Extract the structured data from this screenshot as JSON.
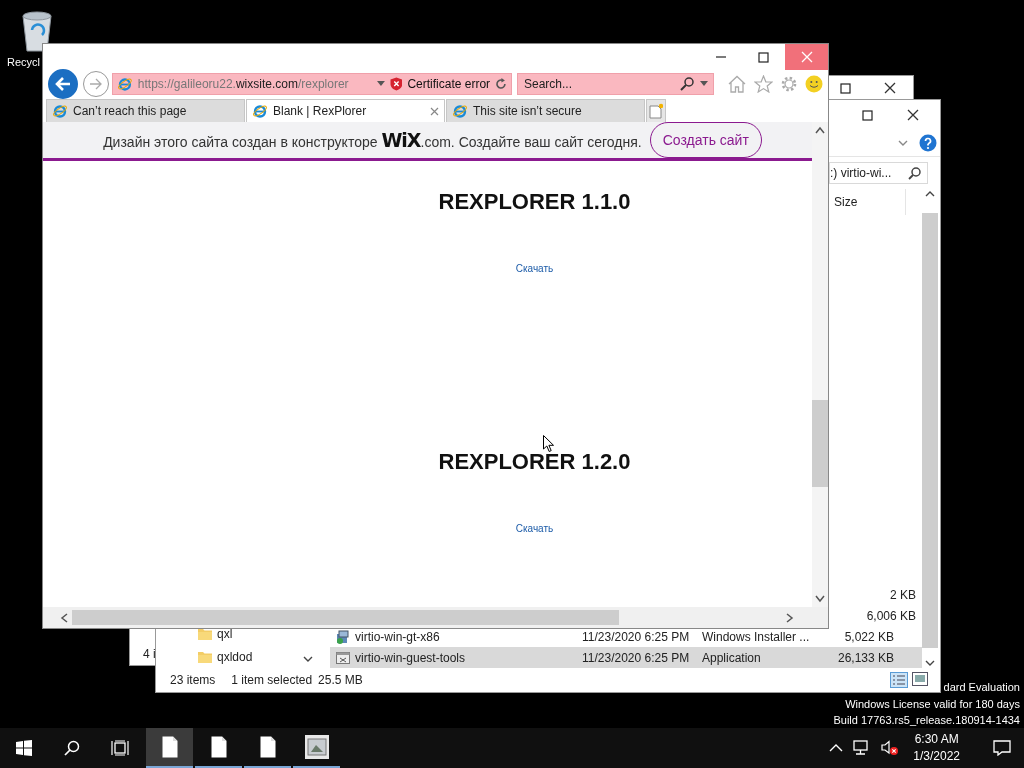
{
  "desktop": {
    "icons": [
      {
        "label": "Recycl"
      }
    ],
    "license_lines": [
      "dard Evaluation",
      "Windows License valid for 180 days",
      "Build 17763.rs5_release.180914-1434"
    ]
  },
  "explorer_back": {
    "status_text": "4 i"
  },
  "explorer": {
    "address": ":) virtio-wi...",
    "columns": [
      "Size"
    ],
    "nav_items": [
      {
        "label": "qxl"
      },
      {
        "label": "qxldod"
      }
    ],
    "files": [
      {
        "size": "2 KB",
        "selected": false
      },
      {
        "size": "6,006 KB",
        "selected": false
      },
      {
        "kind": "installer",
        "name": "virtio-win-gt-x86",
        "date": "11/23/2020 6:25 PM",
        "type": "Windows Installer ...",
        "size": "5,022 KB",
        "selected": false
      },
      {
        "kind": "application",
        "name": "virtio-win-guest-tools",
        "date": "11/23/2020 6:25 PM",
        "type": "Application",
        "size": "26,133 KB",
        "selected": true
      }
    ],
    "status": {
      "count": "23 items",
      "selection": "1 item selected",
      "size": "25.5 MB"
    }
  },
  "browser": {
    "url": "https://galileoru22.**wixsite.com**/rexplorer",
    "certificate_error": "Certificate error",
    "search_placeholder": "Search...",
    "tabs": [
      {
        "label": "Can’t reach this page",
        "selected": false
      },
      {
        "label": "Blank | RexPlorer",
        "selected": true
      },
      {
        "label": "This site isn’t secure",
        "selected": false
      }
    ],
    "banner": {
      "text": "Дизайн этого сайта создан в конструкторе **WiX**.com. Создайте ваш сайт сегодня.",
      "button": "Создать сайт"
    },
    "releases": [
      {
        "title": "REXPLORER 1.1.0",
        "link": "Скачать"
      },
      {
        "title": "REXPLORER 1.2.0",
        "link": "Скачать"
      }
    ]
  },
  "taskbar": {
    "apps": [
      {
        "kind": "document",
        "selected": true
      },
      {
        "kind": "document",
        "selected": false
      },
      {
        "kind": "document",
        "selected": false
      },
      {
        "kind": "application",
        "selected": false
      }
    ],
    "clock": {
      "time": "6:30 AM",
      "date": "1/3/2022"
    }
  }
}
